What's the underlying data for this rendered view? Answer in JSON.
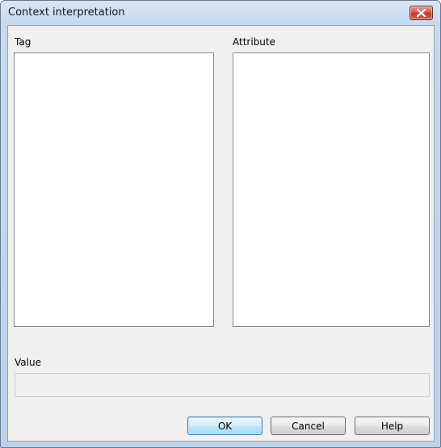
{
  "window": {
    "title": "Context interpretation"
  },
  "tag": {
    "label": "Tag",
    "items": []
  },
  "attribute": {
    "label": "Attribute",
    "items": []
  },
  "value": {
    "label": "Value",
    "text": ""
  },
  "buttons": {
    "ok": "OK",
    "cancel": "Cancel",
    "help": "Help"
  },
  "colors": {
    "titlebar": "#c6d9ee",
    "client": "#f0f0f0",
    "close_button": "#c0392b",
    "default_button_border": "#3c7fb1"
  },
  "icons": {
    "close": "close-icon"
  }
}
